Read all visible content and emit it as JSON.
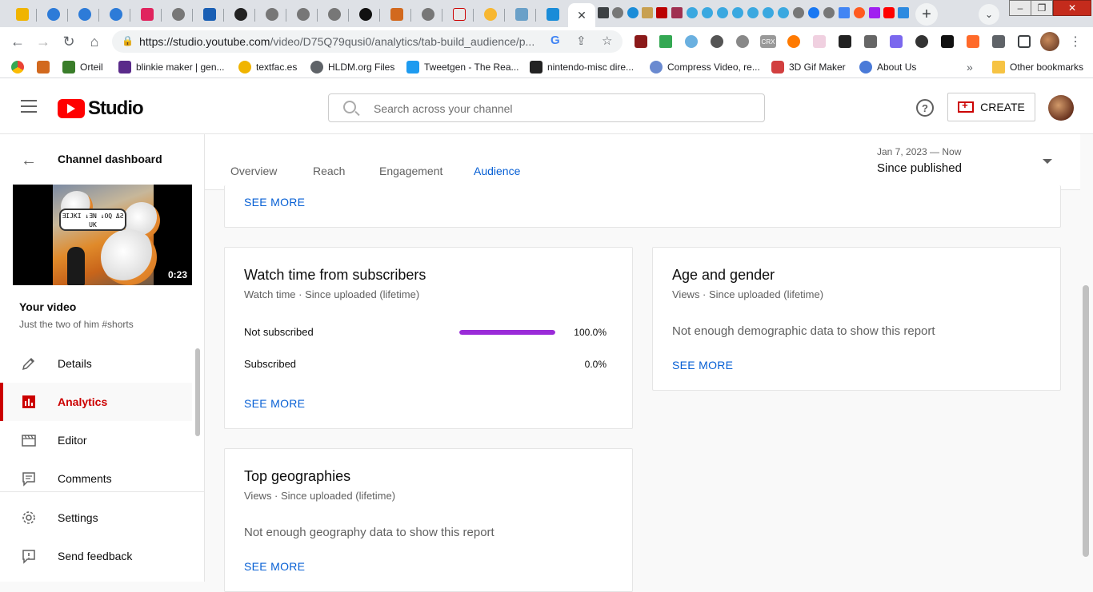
{
  "browser": {
    "url_host": "https://studio.youtube.com",
    "url_path": "/video/D75Q79qusi0/analytics/tab-build_audience/p...",
    "bookmarks": [
      {
        "label": "Orteil",
        "color": "#3a7d2a"
      },
      {
        "label": "blinkie maker | gen...",
        "color": "#5a2a8a"
      },
      {
        "label": "textfac.es",
        "color": "#f0b400"
      },
      {
        "label": "HLDM.org Files",
        "color": "#5f6368"
      },
      {
        "label": "Tweetgen - The Rea...",
        "color": "#1d9bf0"
      },
      {
        "label": "nintendo-misc dire...",
        "color": "#222222"
      },
      {
        "label": "Compress Video, re...",
        "color": "#6a8ad0"
      },
      {
        "label": "3D Gif Maker",
        "color": "#d23f3f"
      },
      {
        "label": "About Us",
        "color": "#4a7ad8"
      }
    ],
    "bookmarks_overflow": "»",
    "other_bookmarks": "Other bookmarks"
  },
  "header": {
    "logo_text": "Studio",
    "search_placeholder": "Search across your channel",
    "help_glyph": "?",
    "create_label": "CREATE"
  },
  "sidebar": {
    "back_label": "Channel dashboard",
    "video_duration": "0:23",
    "thumb_caption": "ƎIJKI ↓ƎN ↓OQ ΔƧ UK",
    "your_video": "Your video",
    "video_title": "Just the two of him #shorts",
    "items": [
      {
        "label": "Details",
        "icon": "pencil-icon"
      },
      {
        "label": "Analytics",
        "icon": "analytics-icon",
        "active": true
      },
      {
        "label": "Editor",
        "icon": "clapper-icon"
      },
      {
        "label": "Comments",
        "icon": "comment-icon"
      },
      {
        "label": "Settings",
        "icon": "gear-icon"
      },
      {
        "label": "Send feedback",
        "icon": "feedback-icon"
      }
    ]
  },
  "analytics": {
    "tabs": [
      "Overview",
      "Reach",
      "Engagement",
      "Audience"
    ],
    "active_tab": "Audience",
    "date_range": "Jan 7, 2023 — Now",
    "date_label": "Since published"
  },
  "cards": {
    "top_see_more": "SEE MORE",
    "watch_time": {
      "title": "Watch time from subscribers",
      "subtitle": "Watch time · Since uploaded (lifetime)",
      "rows": [
        {
          "label": "Not subscribed",
          "value": "100.0%",
          "fraction": 1.0
        },
        {
          "label": "Subscribed",
          "value": "0.0%",
          "fraction": 0.0
        }
      ],
      "see_more": "SEE MORE",
      "bar_color": "#9a2bd8"
    },
    "age_gender": {
      "title": "Age and gender",
      "subtitle": "Views · Since uploaded (lifetime)",
      "message": "Not enough demographic data to show this report",
      "see_more": "SEE MORE"
    },
    "geographies": {
      "title": "Top geographies",
      "subtitle": "Views · Since uploaded (lifetime)",
      "message": "Not enough geography data to show this report",
      "see_more": "SEE MORE"
    }
  },
  "colors": {
    "brand_red": "#ff0000",
    "link_blue": "#065fd4",
    "active_red": "#cc0000"
  }
}
